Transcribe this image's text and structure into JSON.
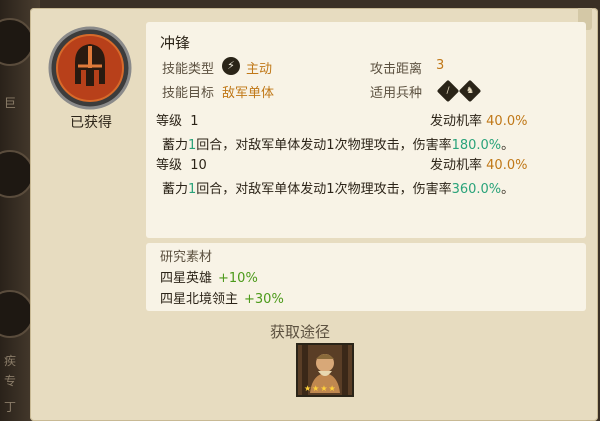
{
  "status": {
    "acquired_label": "已获得"
  },
  "skill": {
    "name": "冲锋",
    "type_label": "技能类型",
    "type_value": "主动",
    "target_label": "技能目标",
    "target_value": "敌军单体",
    "range_label": "攻击距离",
    "range_value": "3",
    "troop_label": "适用兵种",
    "troop_icons": [
      "spear-troop-icon",
      "cavalry-troop-icon"
    ]
  },
  "levels": [
    {
      "level_label": "等级",
      "level_value": "1",
      "rate_label": "发动机率",
      "rate_value": "40.0%",
      "desc_prefix": "蓄力",
      "desc_rounds": "1",
      "desc_middle": "回合，对敌军单体发动1次物理攻击，伤害率",
      "desc_damage": "180.0%",
      "desc_suffix": "。"
    },
    {
      "level_label": "等级",
      "level_value": "10",
      "rate_label": "发动机率",
      "rate_value": "40.0%",
      "desc_prefix": "蓄力",
      "desc_rounds": "1",
      "desc_middle": "回合，对敌军单体发动1次物理攻击，伤害率",
      "desc_damage": "360.0%",
      "desc_suffix": "。"
    }
  ],
  "research": {
    "title": "研究素材",
    "materials": [
      {
        "name": "四星英雄",
        "bonus": "+10%"
      },
      {
        "name": "四星北境领主",
        "bonus": "+30%"
      }
    ]
  },
  "acquire": {
    "title": "获取途径",
    "hero_stars": "★★★★"
  },
  "background": {
    "edge_texts": [
      "巨",
      "疾",
      "专",
      "丁"
    ]
  },
  "colors": {
    "panel": "#e7dcc0",
    "box": "#f8f3e6",
    "orange": "#c07818",
    "green": "#2aa37a",
    "bonus_green": "#4c9a1a"
  }
}
